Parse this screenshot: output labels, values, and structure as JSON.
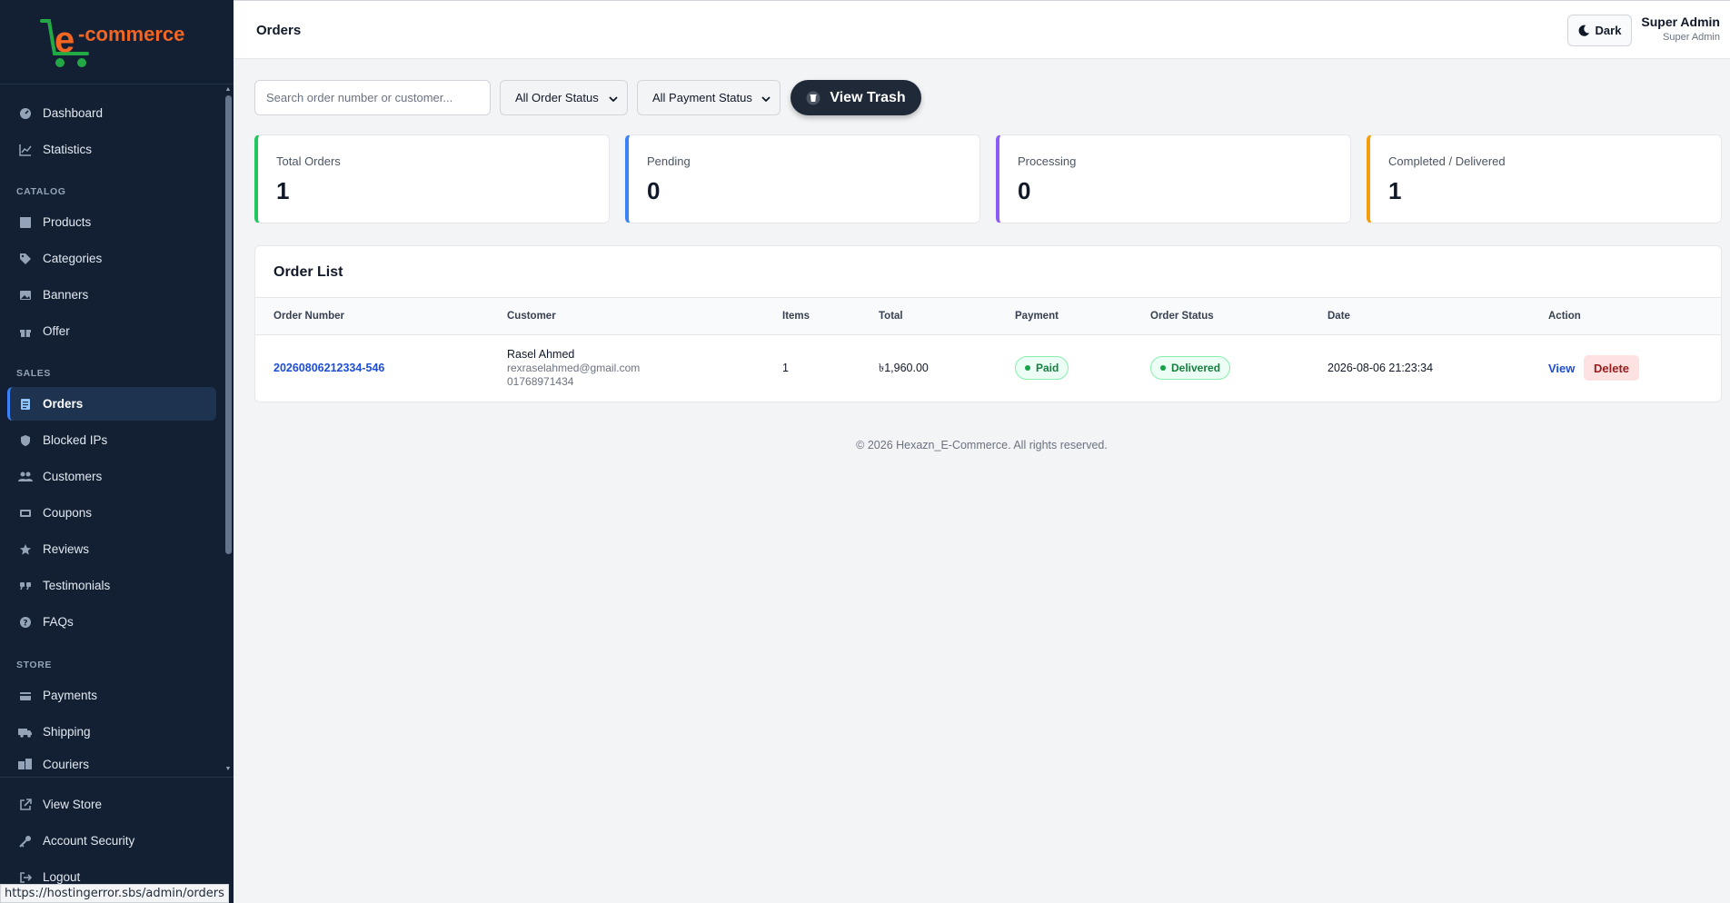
{
  "brand": {
    "logo_letter": "e",
    "logo_text": "-commerce",
    "logo_color": "#f26522",
    "cart_color": "#22a845"
  },
  "sidebar": {
    "items_top": [
      {
        "label": "Dashboard",
        "icon": "dashboard-icon"
      },
      {
        "label": "Statistics",
        "icon": "chart-line-icon"
      }
    ],
    "section_catalog": "CATALOG",
    "items_catalog": [
      {
        "label": "Products",
        "icon": "box-icon"
      },
      {
        "label": "Categories",
        "icon": "tags-icon"
      },
      {
        "label": "Banners",
        "icon": "image-icon"
      },
      {
        "label": "Offer",
        "icon": "gift-icon"
      }
    ],
    "section_sales": "SALES",
    "items_sales": [
      {
        "label": "Orders",
        "icon": "receipt-icon",
        "active": true
      },
      {
        "label": "Blocked IPs",
        "icon": "shield-icon"
      },
      {
        "label": "Customers",
        "icon": "users-icon"
      },
      {
        "label": "Coupons",
        "icon": "ticket-icon"
      },
      {
        "label": "Reviews",
        "icon": "star-icon"
      },
      {
        "label": "Testimonials",
        "icon": "quote-icon"
      },
      {
        "label": "FAQs",
        "icon": "question-icon"
      }
    ],
    "section_store": "STORE",
    "items_store": [
      {
        "label": "Payments",
        "icon": "credit-card-icon"
      },
      {
        "label": "Shipping",
        "icon": "truck-icon"
      },
      {
        "label": "Couriers",
        "icon": "warehouse-icon"
      }
    ],
    "items_bottom": [
      {
        "label": "View Store",
        "icon": "external-link-icon"
      },
      {
        "label": "Account Security",
        "icon": "key-icon"
      },
      {
        "label": "Logout",
        "icon": "logout-icon"
      }
    ]
  },
  "status_bar_url": "https://hostingerror.sbs/admin/orders",
  "header": {
    "title": "Orders",
    "dark_label": "Dark",
    "user_name": "Super Admin",
    "user_role": "Super Admin"
  },
  "filters": {
    "search_placeholder": "Search order number or customer...",
    "order_status": "All Order Status",
    "payment_status": "All Payment Status",
    "trash_label": "View Trash"
  },
  "stats": [
    {
      "label": "Total Orders",
      "value": "1",
      "color": "#22c55e"
    },
    {
      "label": "Pending",
      "value": "0",
      "color": "#3b82f6"
    },
    {
      "label": "Processing",
      "value": "0",
      "color": "#8b5cf6"
    },
    {
      "label": "Completed / Delivered",
      "value": "1",
      "color": "#f59e0b"
    }
  ],
  "order_list": {
    "title": "Order List",
    "columns": [
      "Order Number",
      "Customer",
      "Items",
      "Total",
      "Payment",
      "Order Status",
      "Date",
      "Action"
    ],
    "rows": [
      {
        "order_number": "20260806212334-546",
        "customer_name": "Rasel Ahmed",
        "customer_email": "rexraselahmed@gmail.com",
        "customer_phone": "01768971434",
        "items": "1",
        "total": "৳1,960.00",
        "payment": "Paid",
        "order_status": "Delivered",
        "date": "2026-08-06 21:23:34",
        "view_label": "View",
        "delete_label": "Delete"
      }
    ]
  },
  "footer": "© 2026 Hexazn_E-Commerce. All rights reserved."
}
